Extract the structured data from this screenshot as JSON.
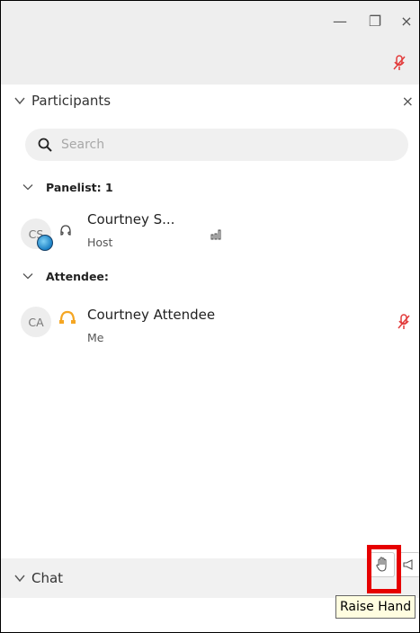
{
  "window": {
    "minimize_glyph": "—",
    "restore_glyph": "❐",
    "close_glyph": "×"
  },
  "participants_panel": {
    "title": "Participants",
    "close_glyph": "×",
    "search": {
      "placeholder": "Search",
      "value": ""
    },
    "groups": [
      {
        "label": "Panelist: 1",
        "members": [
          {
            "initials": "CS",
            "name": "Courtney S...",
            "role": "Host",
            "mic_muted": false
          }
        ]
      },
      {
        "label": "Attendee:",
        "members": [
          {
            "initials": "CA",
            "name": "Courtney Attendee",
            "role": "Me",
            "mic_muted": true
          }
        ]
      }
    ]
  },
  "chat": {
    "title": "Chat"
  },
  "tooltip": {
    "text": "Raise Hand"
  },
  "colors": {
    "accent_muted": "#e23b3b",
    "hand_icon": "#555555",
    "audio_active": "#f5a623"
  }
}
